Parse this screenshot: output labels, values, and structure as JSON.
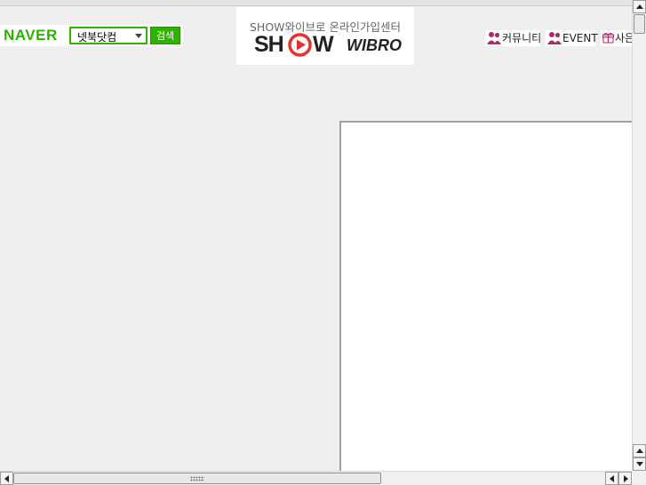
{
  "naver": {
    "logo": "NAVER",
    "query": "넷북닷컴",
    "search_button": "검색"
  },
  "banner": {
    "tagline": "SHOW와이브로 온라인가입센터",
    "brand_sh": "SH",
    "brand_w": "W",
    "brand_wibro": "WIBRO",
    "accent_color": "#e5322d"
  },
  "top_links": [
    {
      "label": "커뮤니티",
      "icon": "people-icon"
    },
    {
      "label": "EVENT",
      "icon": "people-icon"
    },
    {
      "label": "사은",
      "icon": "gift-icon"
    }
  ],
  "colors": {
    "naver_green": "#2db400",
    "link_icon": "#b0286e"
  }
}
